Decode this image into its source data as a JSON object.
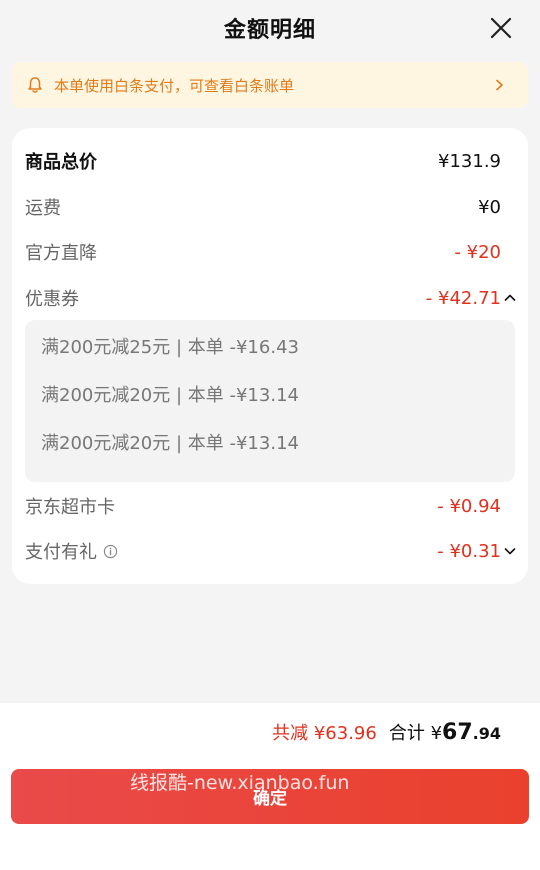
{
  "header": {
    "title": "金额明细"
  },
  "notice": {
    "text": "本单使用白条支付，可查看白条账单"
  },
  "rows": {
    "total_price": {
      "label": "商品总价",
      "value": "¥131.9"
    },
    "shipping": {
      "label": "运费",
      "value": "¥0"
    },
    "official_discount": {
      "label": "官方直降",
      "value": "- ¥20"
    },
    "coupon": {
      "label": "优惠券",
      "value": "- ¥42.71"
    },
    "supermarket_card": {
      "label": "京东超市卡",
      "value": "- ¥0.94"
    },
    "payment_gift": {
      "label": "支付有礼",
      "value": "- ¥0.31"
    }
  },
  "coupons": [
    {
      "text": "满200元减25元 | 本单 -¥16.43"
    },
    {
      "text": "满200元减20元 | 本单 -¥13.14"
    },
    {
      "text": "满200元减20元 | 本单 -¥13.14"
    }
  ],
  "footer": {
    "saved": "共减 ¥63.96",
    "total_label": "合计 ¥",
    "total_integer": "67",
    "total_decimal": ".94",
    "confirm_label": "确定"
  },
  "watermark": "线报酷-new.xianbao.fun",
  "colors": {
    "accent_red": "#e0311d",
    "notice_bg": "#fff6e2",
    "notice_text": "#e07b1a"
  }
}
